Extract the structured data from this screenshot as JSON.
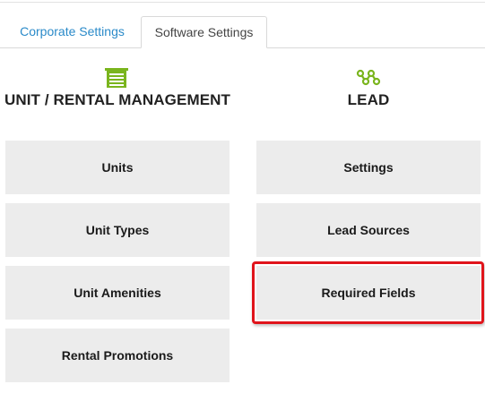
{
  "tabs": [
    {
      "label": "Corporate Settings",
      "active": false
    },
    {
      "label": "Software Settings",
      "active": true
    }
  ],
  "sections": {
    "unit": {
      "title": "UNIT / RENTAL MANAGEMENT",
      "icon": "storage-unit-icon",
      "items": [
        "Units",
        "Unit Types",
        "Unit Amenities",
        "Rental Promotions"
      ]
    },
    "lead": {
      "title": "LEAD",
      "icon": "lead-network-icon",
      "items": [
        "Settings",
        "Lead Sources",
        "Required Fields"
      ]
    }
  },
  "highlighted_item": "Required Fields",
  "colors": {
    "accent_green": "#7ab51d",
    "link_blue": "#2a8ac9",
    "tile_bg": "#ececec",
    "highlight_red": "#e0141b"
  }
}
